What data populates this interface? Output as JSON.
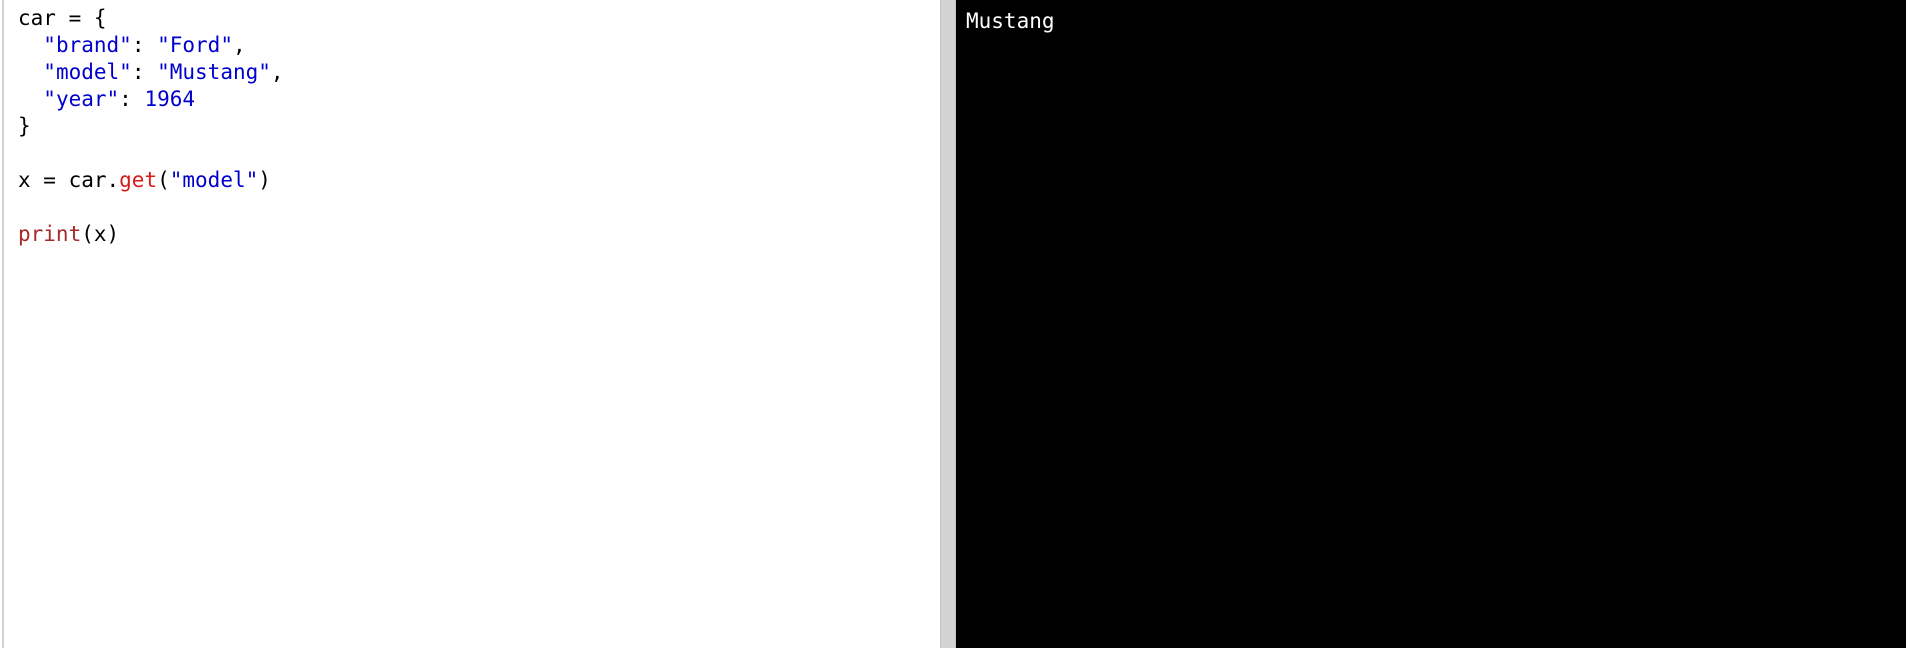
{
  "editor": {
    "lines": [
      [
        {
          "t": "car = {",
          "c": "plain"
        }
      ],
      [
        {
          "t": "  ",
          "c": "plain"
        },
        {
          "t": "\"brand\"",
          "c": "str"
        },
        {
          "t": ": ",
          "c": "plain"
        },
        {
          "t": "\"Ford\"",
          "c": "str"
        },
        {
          "t": ",",
          "c": "plain"
        }
      ],
      [
        {
          "t": "  ",
          "c": "plain"
        },
        {
          "t": "\"model\"",
          "c": "str"
        },
        {
          "t": ": ",
          "c": "plain"
        },
        {
          "t": "\"Mustang\"",
          "c": "str"
        },
        {
          "t": ",",
          "c": "plain"
        }
      ],
      [
        {
          "t": "  ",
          "c": "plain"
        },
        {
          "t": "\"year\"",
          "c": "str"
        },
        {
          "t": ": ",
          "c": "plain"
        },
        {
          "t": "1964",
          "c": "num"
        }
      ],
      [
        {
          "t": "}",
          "c": "plain"
        }
      ],
      [
        {
          "t": "",
          "c": "plain"
        }
      ],
      [
        {
          "t": "x = car.",
          "c": "plain"
        },
        {
          "t": "get",
          "c": "fn"
        },
        {
          "t": "(",
          "c": "plain"
        },
        {
          "t": "\"model\"",
          "c": "str"
        },
        {
          "t": ")",
          "c": "plain"
        }
      ],
      [
        {
          "t": "",
          "c": "plain"
        }
      ],
      [
        {
          "t": "print",
          "c": "builtin"
        },
        {
          "t": "(x)",
          "c": "plain"
        }
      ]
    ]
  },
  "output": {
    "text": "Mustang"
  },
  "colors": {
    "string": "#0000cd",
    "number": "#0000cd",
    "method": "#d81b1b",
    "builtin": "#a52a2a",
    "output_bg": "#000000",
    "output_fg": "#ffffff"
  }
}
